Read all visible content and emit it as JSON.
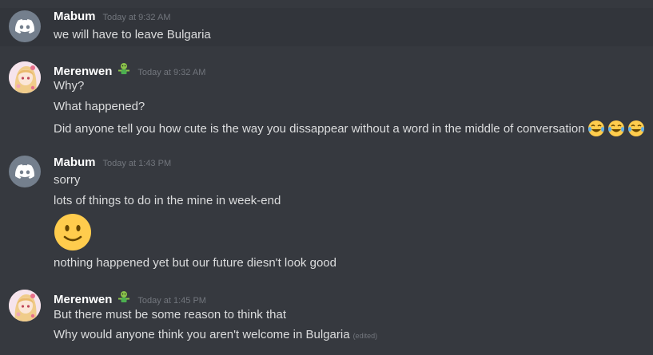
{
  "messages": [
    {
      "author": "Mabum",
      "timestamp": "Today at 9:32 AM",
      "lines": [
        "we will have to leave Bulgaria"
      ]
    },
    {
      "author": "Merenwen",
      "author_emoji": "zombie-emoji",
      "timestamp": "Today at 9:32 AM",
      "lines": [
        "Why?",
        "What happened?",
        "Did anyone tell you how cute is the way you dissappear without a word in the middle of conversation"
      ],
      "trailing_emojis": [
        "joy-emoji",
        "joy-emoji",
        "joy-emoji"
      ]
    },
    {
      "author": "Mabum",
      "timestamp": "Today at 1:43 PM",
      "lines": [
        "sorry",
        "lots of things to do in the mine in week-end",
        "nothing happened yet but our future diesn't look good"
      ],
      "big_emoji": "slightly-smiling-face-emoji"
    },
    {
      "author": "Merenwen",
      "author_emoji": "zombie-emoji",
      "timestamp": "Today at 1:45 PM",
      "lines": [
        "But there must be some reason to think that",
        "Why would anyone think you aren't welcome in Bulgaria"
      ],
      "edited_label": "(edited)"
    }
  ],
  "colors": {
    "background": "#36393f",
    "hover_background": "#32353b",
    "username": "#ffffff",
    "text": "#dcddde",
    "timestamp": "#72767d",
    "discord_avatar": "#747f8d"
  }
}
